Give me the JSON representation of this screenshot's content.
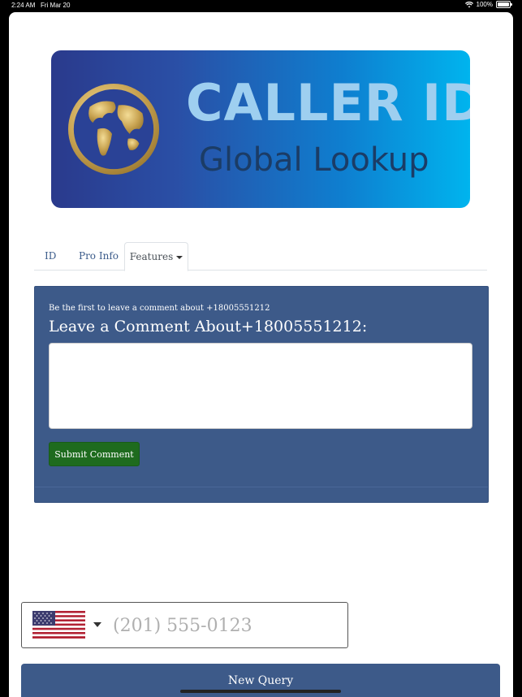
{
  "status": {
    "time": "2:24 AM",
    "date": "Fri Mar 20",
    "battery": "100%"
  },
  "logo": {
    "title": "CALLER ID",
    "subtitle": "Global Lookup"
  },
  "tabs": [
    {
      "label": "ID"
    },
    {
      "label": "Pro Info"
    },
    {
      "label": "Features"
    }
  ],
  "comment": {
    "first_note": "Be the first to leave a comment about +18005551212",
    "heading": "Leave a Comment About+18005551212:",
    "submit_label": "Submit Comment",
    "value": ""
  },
  "phone": {
    "placeholder": "(201) 555-0123",
    "country": "us-flag-icon"
  },
  "footer": {
    "new_query_label": "New Query"
  },
  "colors": {
    "panel": "#3d5a89",
    "submit": "#1e6b1e",
    "tab_text": "#3b5b8a"
  }
}
